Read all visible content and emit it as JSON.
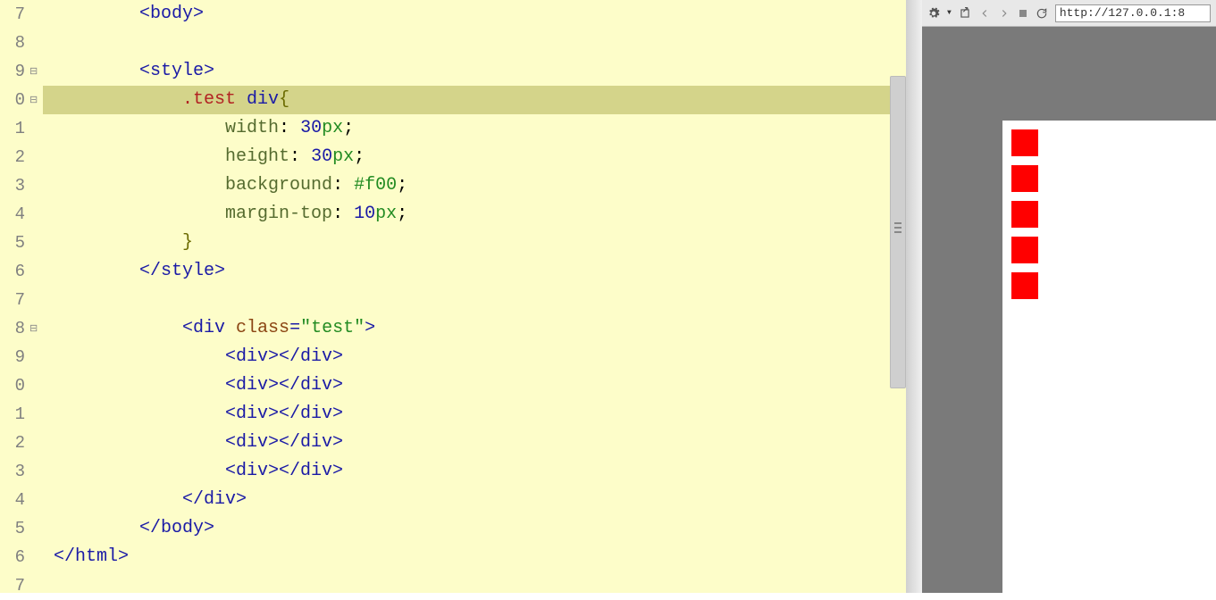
{
  "gutter": [
    "7",
    "8",
    "9",
    "0",
    "1",
    "2",
    "3",
    "4",
    "5",
    "6",
    "7",
    "8",
    "9",
    "0",
    "1",
    "2",
    "3",
    "4",
    "5",
    "6",
    "7"
  ],
  "fold_markers": [
    {
      "line": 2,
      "glyph": "⊟"
    },
    {
      "line": 3,
      "glyph": "⊟"
    },
    {
      "line": 11,
      "glyph": "⊟"
    }
  ],
  "code": {
    "l0": [
      [
        "t-tag",
        "<body>"
      ]
    ],
    "l1": [],
    "l2": [
      [
        "t-tag",
        "<style>"
      ]
    ],
    "l3": [
      [
        "t-sel-class",
        ".test "
      ],
      [
        "t-sel-el",
        "div"
      ],
      [
        "t-brace",
        "{"
      ]
    ],
    "l4": [
      [
        "t-prop",
        "width"
      ],
      [
        "t-punc",
        ": "
      ],
      [
        "t-num",
        "30"
      ],
      [
        "t-unit",
        "px"
      ],
      [
        "t-punc",
        ";"
      ]
    ],
    "l5": [
      [
        "t-prop",
        "height"
      ],
      [
        "t-punc",
        ": "
      ],
      [
        "t-num",
        "30"
      ],
      [
        "t-unit",
        "px"
      ],
      [
        "t-punc",
        ";"
      ]
    ],
    "l6": [
      [
        "t-prop",
        "background"
      ],
      [
        "t-punc",
        ": "
      ],
      [
        "t-val",
        "#f00"
      ],
      [
        "t-punc",
        ";"
      ]
    ],
    "l7": [
      [
        "t-prop",
        "margin-top"
      ],
      [
        "t-punc",
        ": "
      ],
      [
        "t-num",
        "10"
      ],
      [
        "t-unit",
        "px"
      ],
      [
        "t-punc",
        ";"
      ]
    ],
    "l8": [
      [
        "t-brace",
        "}"
      ]
    ],
    "l9": [
      [
        "t-tag",
        "</style>"
      ]
    ],
    "l10": [],
    "l11": [
      [
        "t-tag",
        "<div "
      ],
      [
        "t-attr",
        "class"
      ],
      [
        "t-tag",
        "="
      ],
      [
        "t-str",
        "\"test\""
      ],
      [
        "t-tag",
        ">"
      ]
    ],
    "l12": [
      [
        "t-tag",
        "<div></div>"
      ]
    ],
    "l13": [
      [
        "t-tag",
        "<div></div>"
      ]
    ],
    "l14": [
      [
        "t-tag",
        "<div></div>"
      ]
    ],
    "l15": [
      [
        "t-tag",
        "<div></div>"
      ]
    ],
    "l16": [
      [
        "t-tag",
        "<div></div>"
      ]
    ],
    "l17": [
      [
        "t-tag",
        "</div>"
      ]
    ],
    "l18": [
      [
        "t-tag",
        "</body>"
      ]
    ],
    "l19": [
      [
        "t-tag",
        "</html>"
      ]
    ],
    "l20": []
  },
  "indents": {
    "l0": 2,
    "l1": 0,
    "l2": 2,
    "l3": 3,
    "l4": 4,
    "l5": 4,
    "l6": 4,
    "l7": 4,
    "l8": 3,
    "l9": 2,
    "l10": 0,
    "l11": 3,
    "l12": 4,
    "l13": 4,
    "l14": 4,
    "l15": 4,
    "l16": 4,
    "l17": 3,
    "l18": 2,
    "l19": 0,
    "l20": 0
  },
  "highlighted_line": 3,
  "toolbar": {
    "url": "http://127.0.0.1:8"
  },
  "preview": {
    "box_count": 5
  }
}
